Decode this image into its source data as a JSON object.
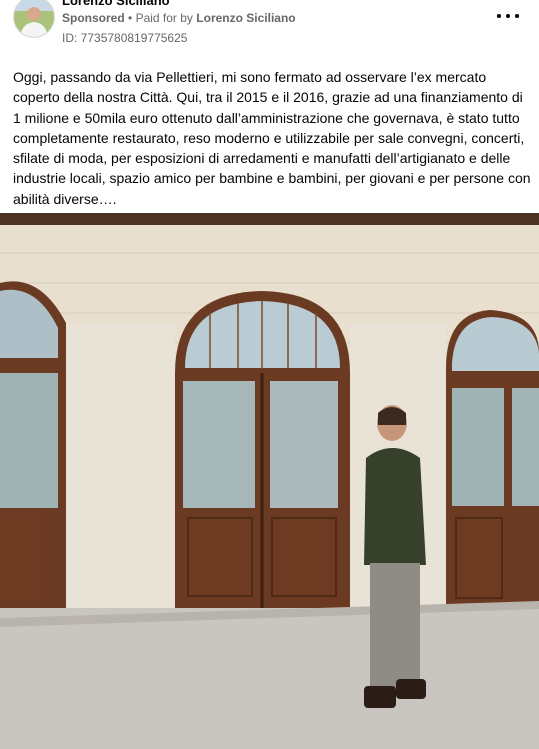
{
  "post": {
    "author": "Lorenzo Siciliano",
    "sponsored": "Sponsored",
    "separator": "•",
    "paid_prefix": "Paid for by",
    "paid_by": "Lorenzo Siciliano",
    "ad_id": "ID: 7735780819775625",
    "more_icon": "more-horizontal-icon",
    "text": "Oggi, passando da via Pellettieri, mi sono fermato ad osservare l’ex mercato coperto della nostra Città. Qui, tra il 2015 e il 2016, grazie ad una finanziamento di 1 milione e 50mila euro ottenuto dall’amministrazione che governava, è stato tutto completamente restaurato, reso moderno e utilizzabile per sale convegni, concerti, sfilate di moda, per esposizioni di arredamenti e manufatti dell’artigianato e delle industrie locali, spazio amico per bambine e bambini, per giovani e per persone con abilità diverse…."
  },
  "colors": {
    "text_primary": "#050505",
    "text_secondary": "#65676b",
    "wall": "#e8dfcf",
    "wood": "#6b3a22",
    "ceiling": "#3f2a1e",
    "floor": "#c9c6c1"
  }
}
